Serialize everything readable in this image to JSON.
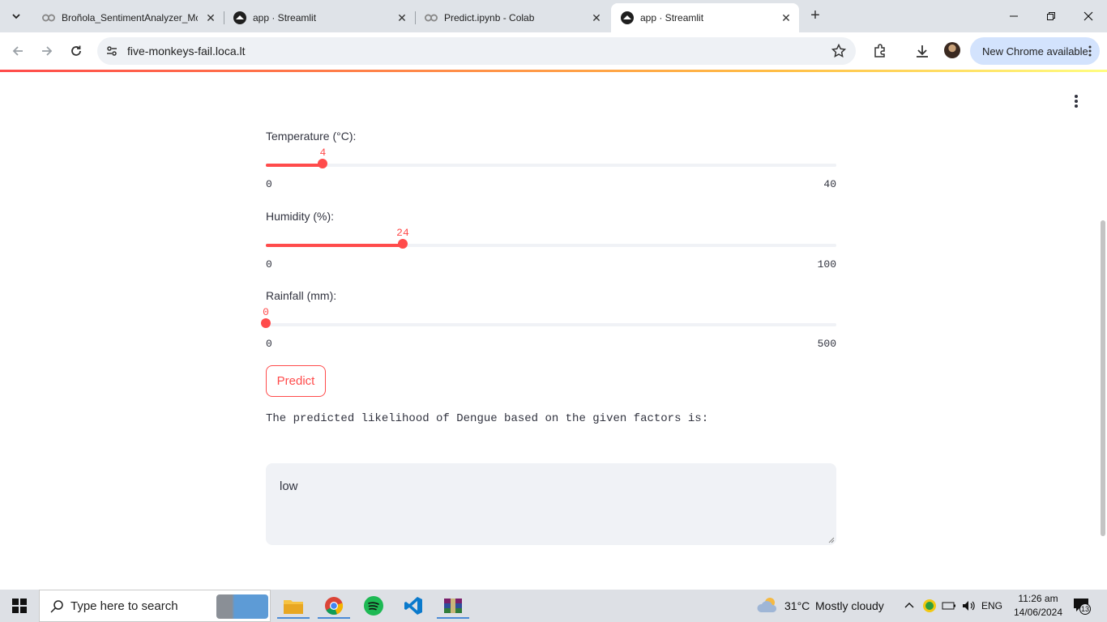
{
  "browser": {
    "tabs": [
      {
        "label": "Broñola_SentimentAnalyzer_Mc",
        "favicon": "colab-icon"
      },
      {
        "label": "app · Streamlit",
        "favicon": "streamlit-icon"
      },
      {
        "label": "Predict.ipynb - Colab",
        "favicon": "colab-icon"
      },
      {
        "label": "app · Streamlit",
        "favicon": "streamlit-icon"
      }
    ],
    "url": "five-monkeys-fail.loca.lt",
    "update_pill": "New Chrome available"
  },
  "app": {
    "sliders": [
      {
        "label": "Temperature (°C):",
        "value": 4,
        "min": 0,
        "max": 40
      },
      {
        "label": "Humidity (%):",
        "value": 24,
        "min": 0,
        "max": 100
      },
      {
        "label": "Rainfall (mm):",
        "value": 0,
        "min": 0,
        "max": 500
      }
    ],
    "predict_label": "Predict",
    "result_text": "The predicted likelihood of Dengue based on the given factors is:",
    "result_value": "low",
    "accent_color": "#ff4b4b"
  },
  "taskbar": {
    "search_placeholder": "Type here to search",
    "weather": "31°C",
    "weather_desc": "Mostly cloudy",
    "lang": "ENG",
    "time": "11:26 am",
    "date": "14/06/2024",
    "notifications": "13"
  }
}
